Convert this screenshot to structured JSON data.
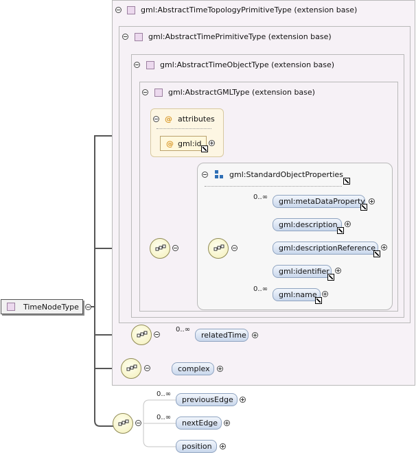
{
  "diagram": {
    "root": {
      "label": "TimeNodeType"
    },
    "extensions": [
      {
        "label": "gml:AbstractTimeTopologyPrimitiveType (extension base)"
      },
      {
        "label": "gml:AbstractTimePrimitiveType (extension base)"
      },
      {
        "label": "gml:AbstractTimeObjectType (extension base)"
      },
      {
        "label": "gml:AbstractGMLType (extension base)"
      }
    ],
    "attributes": {
      "label": "attributes",
      "item": "gml:id"
    },
    "group": {
      "label": "gml:StandardObjectProperties"
    },
    "group_elements": [
      {
        "label": "gml:metaDataProperty",
        "card": "0..∞"
      },
      {
        "label": "gml:description",
        "card": ""
      },
      {
        "label": "gml:descriptionReference",
        "card": ""
      },
      {
        "label": "gml:identifier",
        "card": ""
      },
      {
        "label": "gml:name",
        "card": "0..∞"
      }
    ],
    "related_time": {
      "label": "relatedTime",
      "card": "0..∞"
    },
    "complex": {
      "label": "complex"
    },
    "bottom_elements": [
      {
        "label": "previousEdge",
        "card": "0..∞"
      },
      {
        "label": "nextEdge",
        "card": "0..∞"
      },
      {
        "label": "position",
        "card": ""
      }
    ]
  },
  "colors": {
    "compositor_fill": "#f3efb8",
    "element_fill": "#c9d7ec",
    "extension_fill": "#f7f2f7",
    "attributes_fill": "#fdf6e3",
    "wire": "#555555"
  }
}
